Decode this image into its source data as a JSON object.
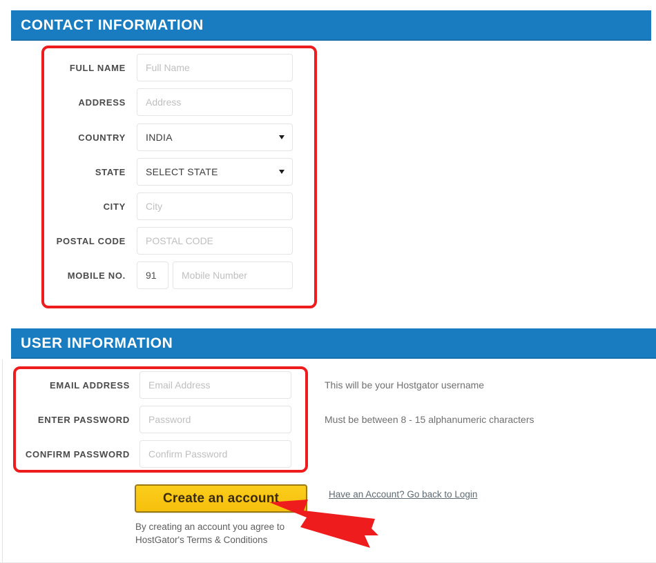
{
  "theme": {
    "header_blue": "#1a7cc0",
    "annotation_red": "#ee1c1c",
    "button_yellow": "#fbcd1b",
    "button_border": "#9a7a10",
    "label_gray": "#4a4a4a",
    "placeholder_gray": "#bfbfbf",
    "link_gray_blue": "#5d6a72"
  },
  "contact_section": {
    "title": "CONTACT INFORMATION",
    "fields": [
      {
        "label": "FULL NAME",
        "placeholder": "Full Name",
        "type": "text"
      },
      {
        "label": "ADDRESS",
        "placeholder": "Address",
        "type": "text"
      },
      {
        "label": "COUNTRY",
        "value": "INDIA",
        "type": "select"
      },
      {
        "label": "STATE",
        "value": "SELECT STATE",
        "type": "select"
      },
      {
        "label": "CITY",
        "placeholder": "City",
        "type": "text"
      },
      {
        "label": "POSTAL CODE",
        "placeholder": "POSTAL CODE",
        "type": "text"
      },
      {
        "label": "MOBILE NO.",
        "prefix": "91",
        "placeholder": "Mobile Number",
        "type": "phone"
      }
    ]
  },
  "user_section": {
    "title": "USER INFORMATION",
    "fields": [
      {
        "label": "EMAIL ADDRESS",
        "placeholder": "Email Address",
        "type": "text"
      },
      {
        "label": "ENTER PASSWORD",
        "placeholder": "Password",
        "type": "password"
      },
      {
        "label": "CONFIRM PASSWORD",
        "placeholder": "Confirm Password",
        "type": "password"
      }
    ],
    "notes": [
      "This will be your Hostgator username",
      "Must be between 8 - 15 alphanumeric characters"
    ]
  },
  "actions": {
    "submit_label": "Create an account",
    "terms_line1": "By creating an account you agree to",
    "terms_line2": "HostGator's Terms & Conditions",
    "login_link": "Have an Account? Go back to Login"
  },
  "annotations": {
    "arrow_color": "#ee1c1c",
    "arrow_target": "create-account-button"
  }
}
